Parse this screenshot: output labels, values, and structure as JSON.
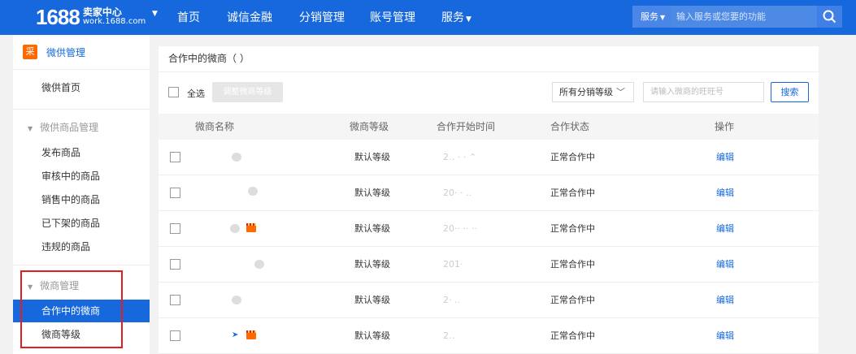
{
  "header": {
    "logo_num": "1688",
    "logo_title": "卖家中心",
    "logo_sub": "work.1688.com",
    "nav": [
      "首页",
      "诚信金融",
      "分销管理",
      "账号管理",
      "服务"
    ],
    "search_select": "服务",
    "search_placeholder": "输入服务或您要的功能",
    "color_primary": "#1668dc"
  },
  "sidebar": {
    "title": "微供管理",
    "logo_char": "采",
    "home": "微供首页",
    "group_goods": "微供商品管理",
    "goods_items": [
      "发布商品",
      "审核中的商品",
      "销售中的商品",
      "已下架的商品",
      "违规的商品"
    ],
    "group_wx": "微商管理",
    "wx_items": [
      "合作中的微商",
      "微商等级"
    ]
  },
  "main": {
    "title": "合作中的微商（           ）",
    "select_all": "全选",
    "adjust_button": "调整微商等级",
    "level_select": "所有分销等级",
    "wx_placeholder": "请输入微商的旺旺号",
    "search_button": "搜索",
    "columns": [
      "微商名称",
      "微商等级",
      "合作开始时间",
      "合作状态",
      "操作"
    ],
    "rows": [
      {
        "level": "默认等级",
        "date": "2‥ ·   ·  ⌃",
        "status": "正常合作中",
        "action": "编辑"
      },
      {
        "level": "默认等级",
        "date": "20·  ·  ‥",
        "status": "正常合作中",
        "action": "编辑"
      },
      {
        "level": "默认等级",
        "date": "20·· ·· ··",
        "status": "正常合作中",
        "action": "编辑"
      },
      {
        "level": "默认等级",
        "date": "201·",
        "status": "正常合作中",
        "action": "编辑"
      },
      {
        "level": "默认等级",
        "date": "2·  ‥",
        "status": "正常合作中",
        "action": "编辑"
      },
      {
        "level": "默认等级",
        "date": "2‥",
        "status": "正常合作中",
        "action": "编辑"
      }
    ]
  }
}
